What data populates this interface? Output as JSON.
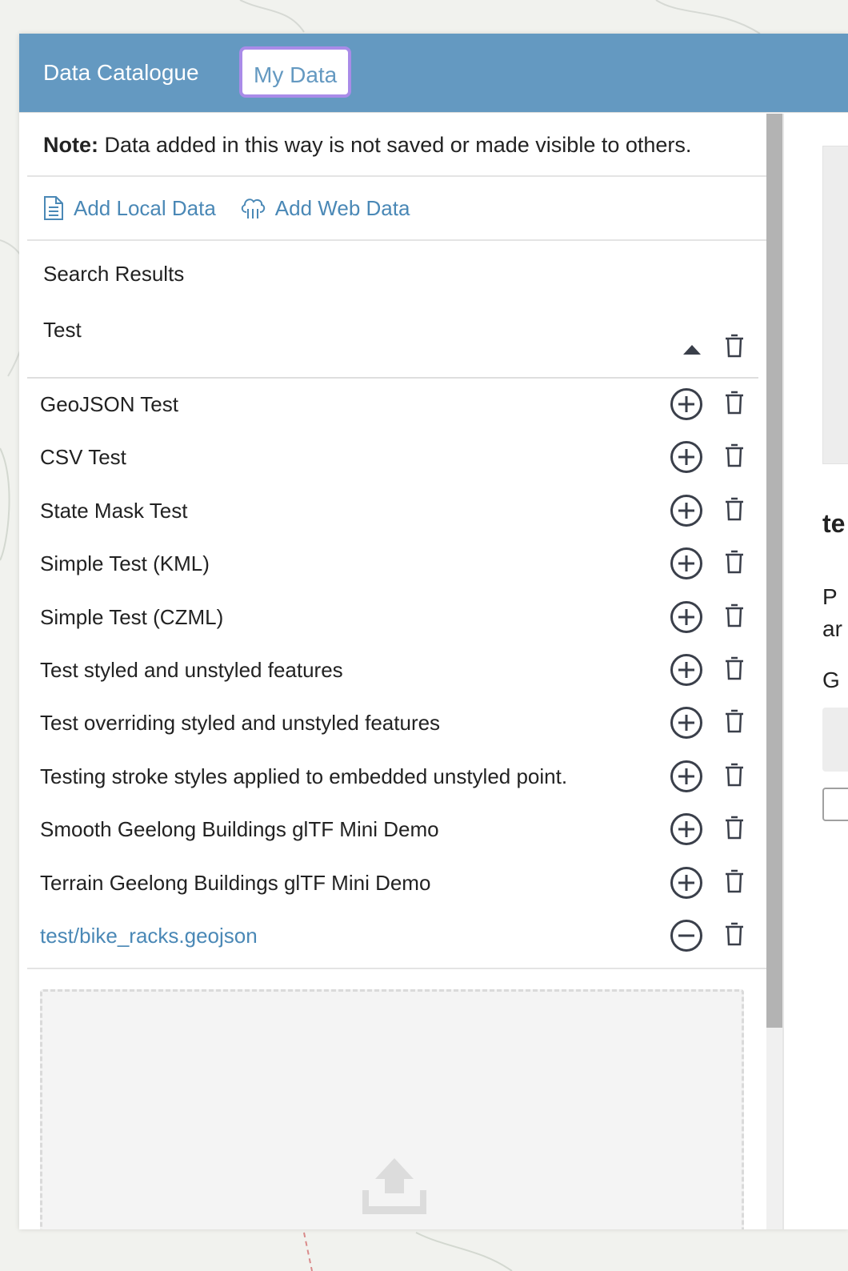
{
  "tabs": {
    "catalogue": "Data Catalogue",
    "my_data": "My Data"
  },
  "note": {
    "bold": "Note:",
    "text": " Data added in this way is not saved or made visible to others."
  },
  "actions": {
    "add_local": "Add Local Data",
    "add_web": "Add Web Data"
  },
  "section_label": "Search Results",
  "group": {
    "title": "Test"
  },
  "items": [
    {
      "label": "GeoJSON Test",
      "state": "add"
    },
    {
      "label": "CSV Test",
      "state": "add"
    },
    {
      "label": "State Mask Test",
      "state": "add"
    },
    {
      "label": "Simple Test (KML)",
      "state": "add"
    },
    {
      "label": "Simple Test (CZML)",
      "state": "add"
    },
    {
      "label": "Test styled and unstyled features",
      "state": "add"
    },
    {
      "label": "Test overriding styled and unstyled features",
      "state": "add"
    },
    {
      "label": "Testing stroke styles applied to embedded unstyled point.",
      "state": "add"
    },
    {
      "label": "Smooth Geelong Buildings glTF Mini Demo",
      "state": "add"
    },
    {
      "label": "Terrain Geelong Buildings glTF Mini Demo",
      "state": "add"
    },
    {
      "label": "test/bike_racks.geojson",
      "state": "remove"
    }
  ],
  "right_pane": {
    "title_partial": "te",
    "para_line1": "P",
    "para_line2": "ar",
    "label_partial": "G"
  },
  "colors": {
    "header_bg": "#6499c1",
    "link": "#4a88b6",
    "active_tab_border": "#a98be8",
    "icon": "#3a3f4a"
  }
}
